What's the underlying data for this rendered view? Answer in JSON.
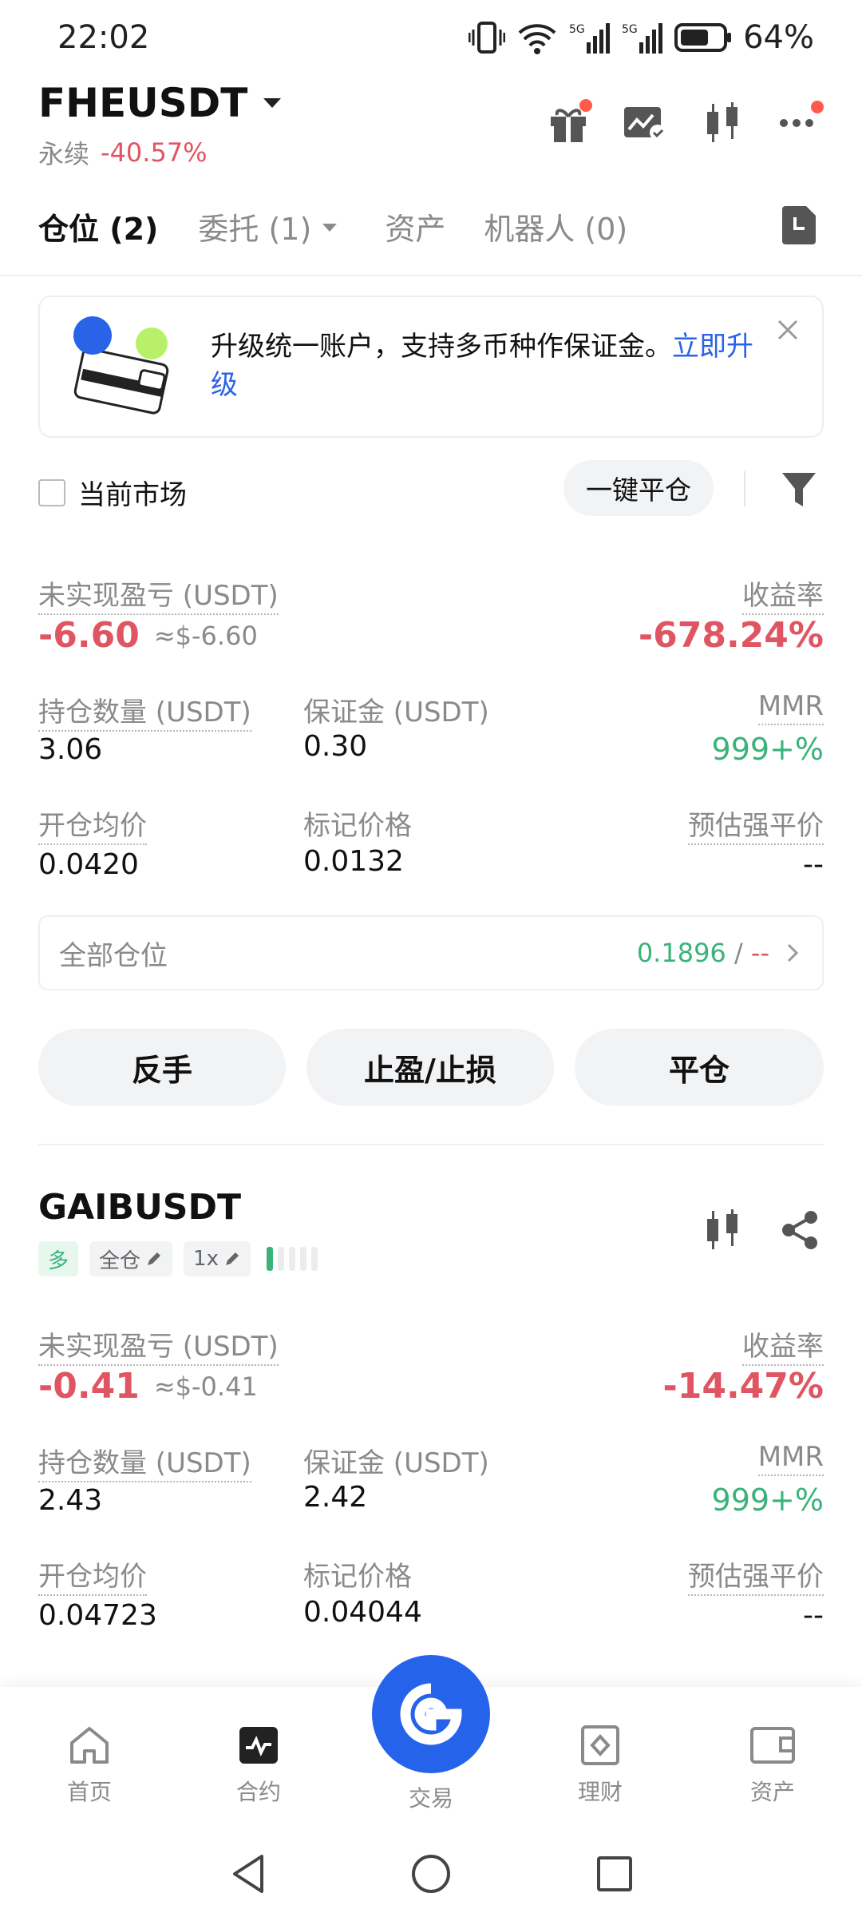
{
  "status_bar": {
    "time": "22:02",
    "net1": "6",
    "net2": "5G",
    "net3": "5G",
    "battery": "64%"
  },
  "header": {
    "symbol": "FHEUSDT",
    "type": "永续",
    "change": "-40.57%"
  },
  "tabs": [
    {
      "label": "仓位 (2)"
    },
    {
      "label": "委托 (1)"
    },
    {
      "label": "资产"
    },
    {
      "label": "机器人 (0)"
    }
  ],
  "banner": {
    "text": "升级统一账户，支持多币种作保证金。",
    "link": "立即升级"
  },
  "filter": {
    "current_market": "当前市场",
    "close_all": "一键平仓"
  },
  "position1": {
    "pnl_label": "未实现盈亏 (USDT)",
    "pnl": "-6.60",
    "pnl_usd": "≈$-6.60",
    "roe_label": "收益率",
    "roe": "-678.24%",
    "qty_label": "持仓数量 (USDT)",
    "qty": "3.06",
    "margin_label": "保证金 (USDT)",
    "margin": "0.30",
    "mmr_label": "MMR",
    "mmr": "999+%",
    "entry_label": "开仓均价",
    "entry": "0.0420",
    "mark_label": "标记价格",
    "mark": "0.0132",
    "liq_label": "预估强平价",
    "liq": "--"
  },
  "all_positions": {
    "label": "全部仓位",
    "value": "0.1896",
    "sep": " / ",
    "value2": "--"
  },
  "actions": {
    "reverse": "反手",
    "tpsl": "止盈/止损",
    "close": "平仓"
  },
  "position2": {
    "symbol": "GAIBUSDT",
    "side": "多",
    "mode": "全仓",
    "leverage": "1x",
    "pnl_label": "未实现盈亏 (USDT)",
    "pnl": "-0.41",
    "pnl_usd": "≈$-0.41",
    "roe_label": "收益率",
    "roe": "-14.47%",
    "qty_label": "持仓数量 (USDT)",
    "qty": "2.43",
    "margin_label": "保证金 (USDT)",
    "margin": "2.42",
    "mmr_label": "MMR",
    "mmr": "999+%",
    "entry_label": "开仓均价",
    "entry": "0.04723",
    "mark_label": "标记价格",
    "mark": "0.04044",
    "liq_label": "预估强平价",
    "liq": "--"
  },
  "bottom_nav": [
    {
      "label": "首页",
      "icon": "home-icon"
    },
    {
      "label": "合约",
      "icon": "futures-icon"
    },
    {
      "label": "交易",
      "icon": "trade-icon"
    },
    {
      "label": "理财",
      "icon": "earn-icon"
    },
    {
      "label": "资产",
      "icon": "wallet-icon"
    }
  ],
  "colors": {
    "red": "#e05562",
    "green": "#3bb27a",
    "blue": "#2a63e8"
  }
}
